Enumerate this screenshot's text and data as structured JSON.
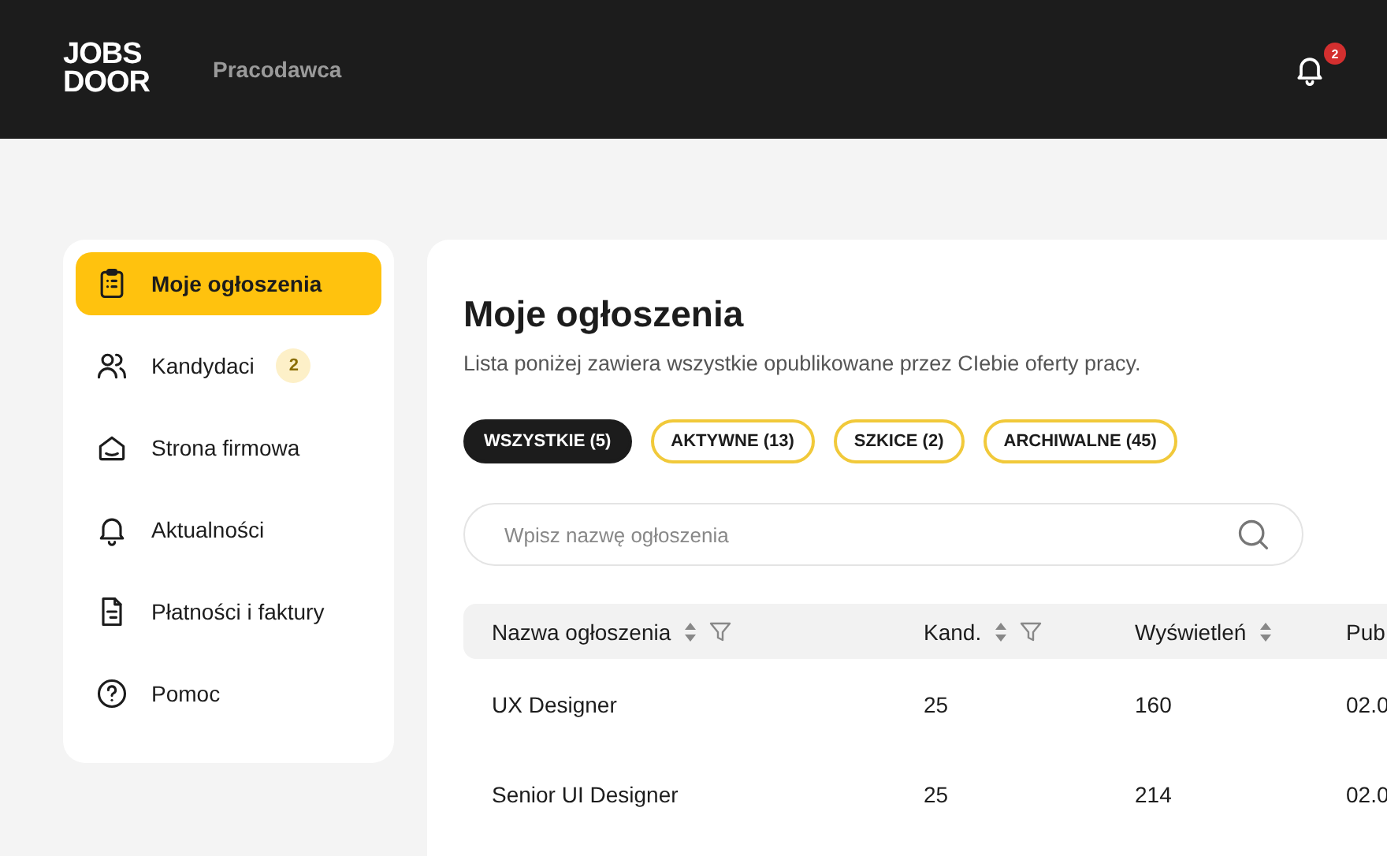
{
  "header": {
    "logo": [
      "JOBS",
      "DOOR"
    ],
    "role": "Pracodawca",
    "notifications": {
      "count": "2"
    }
  },
  "sidebar": {
    "items": [
      {
        "label": "Moje ogłoszenia",
        "selected": true
      },
      {
        "label": "Kandydaci",
        "selected": false,
        "badge": "2"
      },
      {
        "label": "Strona firmowa",
        "selected": false
      },
      {
        "label": "Aktualności",
        "selected": false
      },
      {
        "label": "Płatności i faktury",
        "selected": false
      },
      {
        "label": "Pomoc",
        "selected": false
      }
    ]
  },
  "main": {
    "title": "Moje ogłoszenia",
    "subtitle": "Lista poniżej zawiera wszystkie opublikowane przez CIebie oferty pracy.",
    "filters": [
      {
        "label": "WSZYSTKIE (5)",
        "selected": true
      },
      {
        "label": "AKTYWNE (13)",
        "selected": false
      },
      {
        "label": "SZKICE (2)",
        "selected": false
      },
      {
        "label": "ARCHIWALNE (45)",
        "selected": false
      }
    ],
    "search": {
      "placeholder": "Wpisz nazwę ogłoszenia"
    },
    "table": {
      "columns": [
        {
          "label": "Nazwa ogłoszenia",
          "sortable": true,
          "filterable": true
        },
        {
          "label": "Kand.",
          "sortable": true,
          "filterable": true
        },
        {
          "label": "Wyświetleń",
          "sortable": true,
          "filterable": false
        },
        {
          "label": "Pub"
        }
      ],
      "rows": [
        [
          "UX Designer",
          "25",
          "160",
          "02.0"
        ],
        [
          "Senior UI Designer",
          "25",
          "214",
          "02.0"
        ]
      ]
    }
  }
}
